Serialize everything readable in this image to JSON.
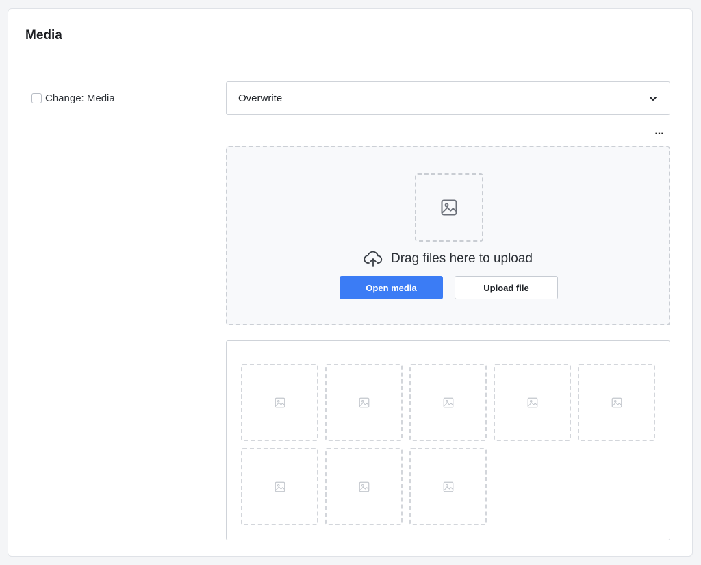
{
  "card": {
    "title": "Media"
  },
  "change_option": {
    "label": "Change: Media",
    "checked": false
  },
  "mode_select": {
    "value": "Overwrite"
  },
  "more_menu": {
    "label": "..."
  },
  "dropzone": {
    "text": "Drag files here to upload",
    "open_media_label": "Open media",
    "upload_file_label": "Upload file"
  },
  "gallery": {
    "placeholder_count": 8
  },
  "colors": {
    "primary": "#3b7cf5",
    "border": "#cfd3d9",
    "dashed_border": "#cbcfd5",
    "dropzone_bg": "#f8f9fb"
  },
  "icons": {
    "chevron": "chevron-down-icon",
    "image": "image-icon",
    "upload": "cloud-upload-icon",
    "more": "more-horizontal-icon"
  }
}
